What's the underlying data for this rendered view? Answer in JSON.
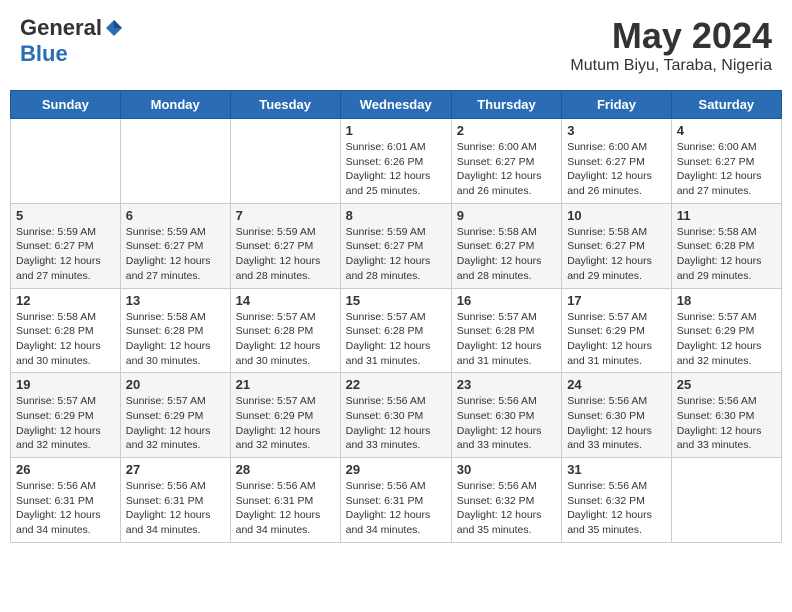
{
  "header": {
    "logo_general": "General",
    "logo_blue": "Blue",
    "month_year": "May 2024",
    "location": "Mutum Biyu, Taraba, Nigeria"
  },
  "days_of_week": [
    "Sunday",
    "Monday",
    "Tuesday",
    "Wednesday",
    "Thursday",
    "Friday",
    "Saturday"
  ],
  "weeks": [
    [
      {
        "day": "",
        "info": ""
      },
      {
        "day": "",
        "info": ""
      },
      {
        "day": "",
        "info": ""
      },
      {
        "day": "1",
        "info": "Sunrise: 6:01 AM\nSunset: 6:26 PM\nDaylight: 12 hours\nand 25 minutes."
      },
      {
        "day": "2",
        "info": "Sunrise: 6:00 AM\nSunset: 6:27 PM\nDaylight: 12 hours\nand 26 minutes."
      },
      {
        "day": "3",
        "info": "Sunrise: 6:00 AM\nSunset: 6:27 PM\nDaylight: 12 hours\nand 26 minutes."
      },
      {
        "day": "4",
        "info": "Sunrise: 6:00 AM\nSunset: 6:27 PM\nDaylight: 12 hours\nand 27 minutes."
      }
    ],
    [
      {
        "day": "5",
        "info": "Sunrise: 5:59 AM\nSunset: 6:27 PM\nDaylight: 12 hours\nand 27 minutes."
      },
      {
        "day": "6",
        "info": "Sunrise: 5:59 AM\nSunset: 6:27 PM\nDaylight: 12 hours\nand 27 minutes."
      },
      {
        "day": "7",
        "info": "Sunrise: 5:59 AM\nSunset: 6:27 PM\nDaylight: 12 hours\nand 28 minutes."
      },
      {
        "day": "8",
        "info": "Sunrise: 5:59 AM\nSunset: 6:27 PM\nDaylight: 12 hours\nand 28 minutes."
      },
      {
        "day": "9",
        "info": "Sunrise: 5:58 AM\nSunset: 6:27 PM\nDaylight: 12 hours\nand 28 minutes."
      },
      {
        "day": "10",
        "info": "Sunrise: 5:58 AM\nSunset: 6:27 PM\nDaylight: 12 hours\nand 29 minutes."
      },
      {
        "day": "11",
        "info": "Sunrise: 5:58 AM\nSunset: 6:28 PM\nDaylight: 12 hours\nand 29 minutes."
      }
    ],
    [
      {
        "day": "12",
        "info": "Sunrise: 5:58 AM\nSunset: 6:28 PM\nDaylight: 12 hours\nand 30 minutes."
      },
      {
        "day": "13",
        "info": "Sunrise: 5:58 AM\nSunset: 6:28 PM\nDaylight: 12 hours\nand 30 minutes."
      },
      {
        "day": "14",
        "info": "Sunrise: 5:57 AM\nSunset: 6:28 PM\nDaylight: 12 hours\nand 30 minutes."
      },
      {
        "day": "15",
        "info": "Sunrise: 5:57 AM\nSunset: 6:28 PM\nDaylight: 12 hours\nand 31 minutes."
      },
      {
        "day": "16",
        "info": "Sunrise: 5:57 AM\nSunset: 6:28 PM\nDaylight: 12 hours\nand 31 minutes."
      },
      {
        "day": "17",
        "info": "Sunrise: 5:57 AM\nSunset: 6:29 PM\nDaylight: 12 hours\nand 31 minutes."
      },
      {
        "day": "18",
        "info": "Sunrise: 5:57 AM\nSunset: 6:29 PM\nDaylight: 12 hours\nand 32 minutes."
      }
    ],
    [
      {
        "day": "19",
        "info": "Sunrise: 5:57 AM\nSunset: 6:29 PM\nDaylight: 12 hours\nand 32 minutes."
      },
      {
        "day": "20",
        "info": "Sunrise: 5:57 AM\nSunset: 6:29 PM\nDaylight: 12 hours\nand 32 minutes."
      },
      {
        "day": "21",
        "info": "Sunrise: 5:57 AM\nSunset: 6:29 PM\nDaylight: 12 hours\nand 32 minutes."
      },
      {
        "day": "22",
        "info": "Sunrise: 5:56 AM\nSunset: 6:30 PM\nDaylight: 12 hours\nand 33 minutes."
      },
      {
        "day": "23",
        "info": "Sunrise: 5:56 AM\nSunset: 6:30 PM\nDaylight: 12 hours\nand 33 minutes."
      },
      {
        "day": "24",
        "info": "Sunrise: 5:56 AM\nSunset: 6:30 PM\nDaylight: 12 hours\nand 33 minutes."
      },
      {
        "day": "25",
        "info": "Sunrise: 5:56 AM\nSunset: 6:30 PM\nDaylight: 12 hours\nand 33 minutes."
      }
    ],
    [
      {
        "day": "26",
        "info": "Sunrise: 5:56 AM\nSunset: 6:31 PM\nDaylight: 12 hours\nand 34 minutes."
      },
      {
        "day": "27",
        "info": "Sunrise: 5:56 AM\nSunset: 6:31 PM\nDaylight: 12 hours\nand 34 minutes."
      },
      {
        "day": "28",
        "info": "Sunrise: 5:56 AM\nSunset: 6:31 PM\nDaylight: 12 hours\nand 34 minutes."
      },
      {
        "day": "29",
        "info": "Sunrise: 5:56 AM\nSunset: 6:31 PM\nDaylight: 12 hours\nand 34 minutes."
      },
      {
        "day": "30",
        "info": "Sunrise: 5:56 AM\nSunset: 6:32 PM\nDaylight: 12 hours\nand 35 minutes."
      },
      {
        "day": "31",
        "info": "Sunrise: 5:56 AM\nSunset: 6:32 PM\nDaylight: 12 hours\nand 35 minutes."
      },
      {
        "day": "",
        "info": ""
      }
    ]
  ]
}
